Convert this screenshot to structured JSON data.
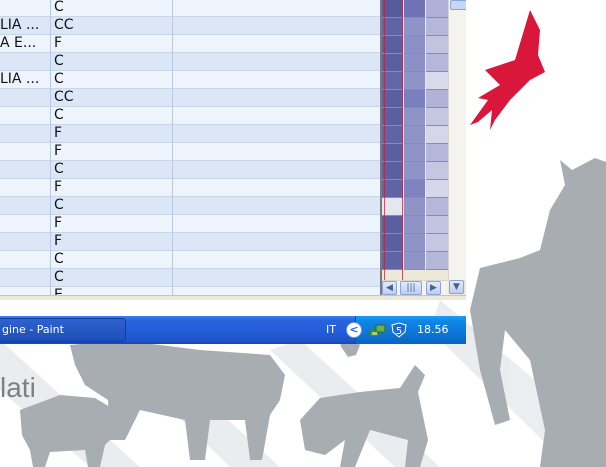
{
  "spreadsheet": {
    "rows": [
      {
        "a": "",
        "b": "C"
      },
      {
        "a": "LIA ...",
        "b": "CC"
      },
      {
        "a": "A E...",
        "b": "F"
      },
      {
        "a": "",
        "b": "C"
      },
      {
        "a": "LIA ...",
        "b": "C"
      },
      {
        "a": "",
        "b": "CC"
      },
      {
        "a": "",
        "b": "C"
      },
      {
        "a": "",
        "b": "F"
      },
      {
        "a": "",
        "b": "F"
      },
      {
        "a": "",
        "b": "C"
      },
      {
        "a": "",
        "b": "F"
      },
      {
        "a": "",
        "b": "C"
      },
      {
        "a": "",
        "b": "F"
      },
      {
        "a": "",
        "b": "F"
      },
      {
        "a": "",
        "b": "C"
      },
      {
        "a": "",
        "b": "C"
      },
      {
        "a": "",
        "b": "E"
      }
    ],
    "palette": {
      "col1": [
        "#555a9a",
        "#5f64a6",
        "#5a5fa0",
        "#5a5fa0",
        "#6166a6",
        "#5a5fa0",
        "#5a5fa0",
        "#5f64a6",
        "#5a5fa0",
        "#5a5fa0",
        "#5f64a6",
        "#e6e6ee",
        "#5a5fa0",
        "#5a5fa0",
        "#5f64a6"
      ],
      "col2": [
        "#6f73b5",
        "#8f93c5",
        "#8c90c6",
        "#8c90c6",
        "#8f93c5",
        "#7a7fbd",
        "#8f93c5",
        "#8f93c5",
        "#8f93c5",
        "#8f93c5",
        "#7f83c0",
        "#8f93c5",
        "#8f93c5",
        "#8f93c5",
        "#8f93c5"
      ],
      "col3": [
        "#aeb0d6",
        "#b5b7da",
        "#c2c3e0",
        "#b5b7da",
        "#d9d9ec",
        "#b0b2d8",
        "#c5c6e2",
        "#d5d6ea",
        "#b5b7da",
        "#c5c6e2",
        "#d6d7eb",
        "#b5b7da",
        "#c2c3e0",
        "#c5c6e2",
        "#b5b7da"
      ]
    }
  },
  "taskbar": {
    "task_label": "gine - Paint",
    "language": "IT",
    "clock": "18.56",
    "tray_arrow_label": "<"
  },
  "desktop": {
    "label": "lati"
  },
  "colors": {
    "bird": "#d8173a",
    "silhouette": "#a8adb2",
    "taskbar": "#245edb"
  }
}
